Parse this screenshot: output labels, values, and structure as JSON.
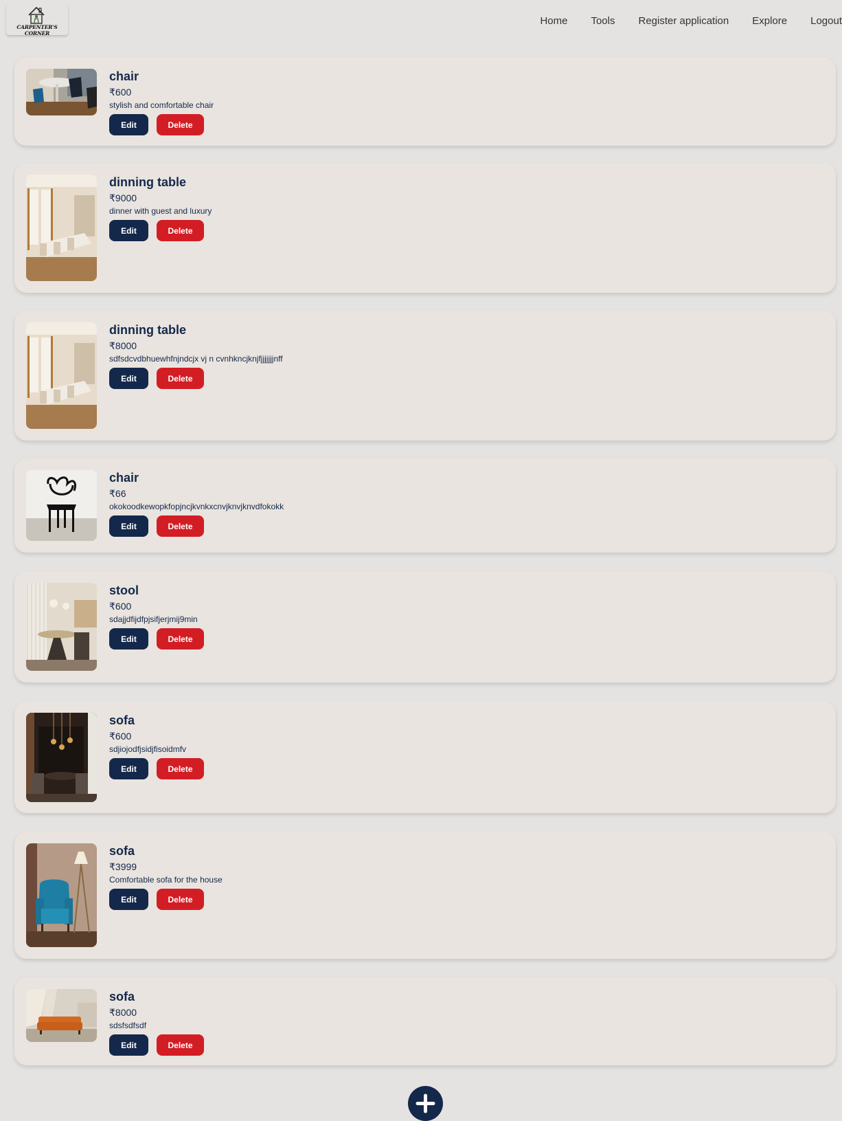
{
  "brand": {
    "name": "CARPENTER'S CORNER"
  },
  "nav": {
    "home": "Home",
    "tools": "Tools",
    "register": "Register application",
    "explore": "Explore",
    "logout": "Logout"
  },
  "actions": {
    "edit_label": "Edit",
    "delete_label": "Delete"
  },
  "products": [
    {
      "name": "chair",
      "price": "₹600",
      "description": "stylish and comfortable chair"
    },
    {
      "name": "dinning table",
      "price": "₹9000",
      "description": "dinner with guest and luxury"
    },
    {
      "name": "dinning table",
      "price": "₹8000",
      "description": "sdfsdcvdbhuewhfnjndcjx vj n cvnhkncjknjfjjjjjjjnff"
    },
    {
      "name": "chair",
      "price": "₹66",
      "description": "okokoodkewopkfopjncjkvnkxcnvjknvjknvdfokokk"
    },
    {
      "name": "stool",
      "price": "₹600",
      "description": "sdajjdfijdfpjsifjerjmij9min"
    },
    {
      "name": "sofa",
      "price": "₹600",
      "description": "sdjiojodfjsidjfisoidmfv"
    },
    {
      "name": "sofa",
      "price": "₹3999",
      "description": "Comfortable sofa for the house"
    },
    {
      "name": "sofa",
      "price": "₹8000",
      "description": "sdsfsdfsdf"
    }
  ],
  "colors": {
    "primary": "#14284b",
    "danger": "#d31d24",
    "card": "#e9e4df",
    "page": "#e4e3e1"
  },
  "icons": {
    "add": "plus-icon",
    "logo": "house-icon"
  }
}
